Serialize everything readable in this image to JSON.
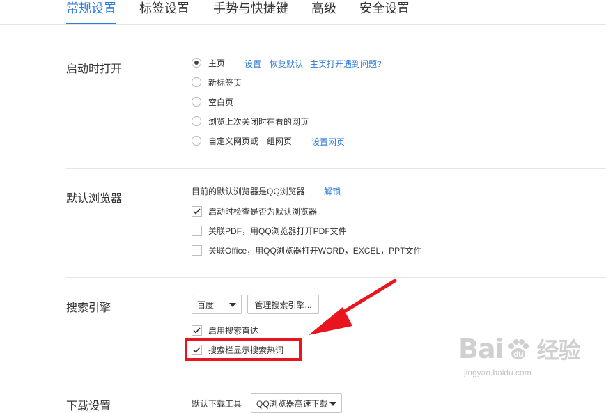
{
  "tabs": [
    {
      "label": "常规设置",
      "active": true
    },
    {
      "label": "标签设置"
    },
    {
      "label": "手势与快捷键"
    },
    {
      "label": "高级"
    },
    {
      "label": "安全设置"
    }
  ],
  "startup": {
    "title": "启动时打开",
    "options": [
      {
        "label": "主页",
        "checked": true
      },
      {
        "label": "新标签页"
      },
      {
        "label": "空白页"
      },
      {
        "label": "浏览上次关闭时在看的网页"
      },
      {
        "label": "自定义网页或一组网页"
      }
    ],
    "links": {
      "settings": "设置",
      "restore_default": "恢复默认",
      "homepage_problem": "主页打开遇到问题?",
      "set_pages": "设置网页"
    }
  },
  "default_browser": {
    "title": "默认浏览器",
    "status": "目前的默认浏览器是QQ浏览器",
    "unlock_link": "解锁",
    "options": [
      {
        "label": "启动时检查是否为默认浏览器",
        "checked": true
      },
      {
        "label": "关联PDF，用QQ浏览器打开PDF文件",
        "checked": false
      },
      {
        "label": "关联Office，用QQ浏览器打开WORD，EXCEL，PPT文件",
        "checked": false
      }
    ]
  },
  "search": {
    "title": "搜索引擎",
    "engine_selected": "百度",
    "manage_button": "管理搜索引擎...",
    "options": [
      {
        "label": "启用搜索直达",
        "checked": true
      },
      {
        "label": "搜索栏显示搜索热词",
        "checked": true
      }
    ]
  },
  "download": {
    "title": "下载设置",
    "tool_label": "默认下载工具",
    "tool_selected": "QQ浏览器高速下载"
  },
  "annotation": {
    "color": "#e8141e"
  },
  "watermark": {
    "brand_left": "Bai",
    "brand_right": "经验",
    "url": "jingyan.baidu.com"
  },
  "colors": {
    "accent": "#2f7bd8",
    "text": "#333333",
    "divider": "#e6e6e6"
  }
}
